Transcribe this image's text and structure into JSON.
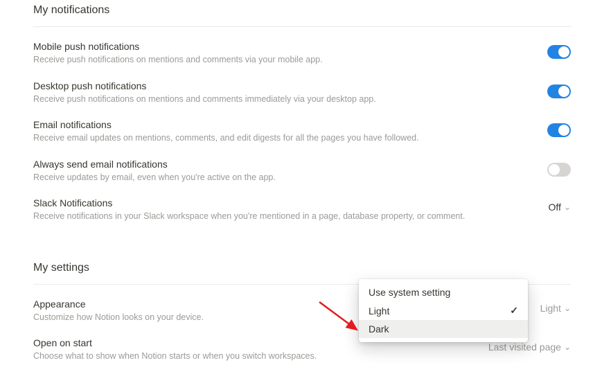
{
  "notifications": {
    "heading": "My notifications",
    "items": [
      {
        "title": "Mobile push notifications",
        "desc": "Receive push notifications on mentions and comments via your mobile app.",
        "type": "toggle",
        "state": "on"
      },
      {
        "title": "Desktop push notifications",
        "desc": "Receive push notifications on mentions and comments immediately via your desktop app.",
        "type": "toggle",
        "state": "on"
      },
      {
        "title": "Email notifications",
        "desc": "Receive email updates on mentions, comments, and edit digests for all the pages you have followed.",
        "type": "toggle",
        "state": "on"
      },
      {
        "title": "Always send email notifications",
        "desc": "Receive updates by email, even when you're active on the app.",
        "type": "toggle",
        "state": "off"
      },
      {
        "title": "Slack Notifications",
        "desc": "Receive notifications in your Slack workspace when you're mentioned in a page, database property, or comment.",
        "type": "select",
        "value": "Off"
      }
    ]
  },
  "settings": {
    "heading": "My settings",
    "items": [
      {
        "title": "Appearance",
        "desc": "Customize how Notion looks on your device.",
        "type": "select",
        "value": "Light"
      },
      {
        "title": "Open on start",
        "desc": "Choose what to show when Notion starts or when you switch workspaces.",
        "type": "select",
        "value": "Last visited page"
      }
    ]
  },
  "dropdown": {
    "options": [
      {
        "label": "Use system setting",
        "selected": false,
        "hovered": false
      },
      {
        "label": "Light",
        "selected": true,
        "hovered": false
      },
      {
        "label": "Dark",
        "selected": false,
        "hovered": true
      }
    ]
  }
}
